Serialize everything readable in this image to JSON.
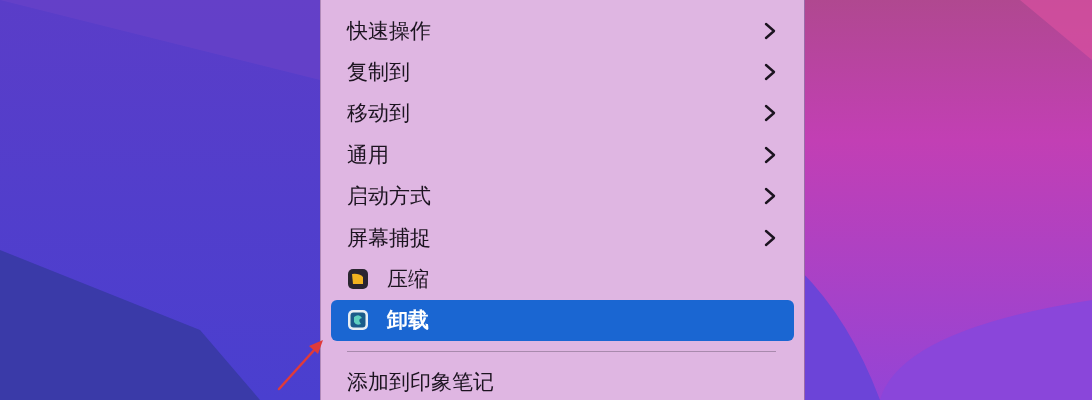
{
  "context_menu": {
    "items": [
      {
        "kind": "submenu",
        "label": "快速操作",
        "selected": false
      },
      {
        "kind": "submenu",
        "label": "复制到",
        "selected": false
      },
      {
        "kind": "submenu",
        "label": "移动到",
        "selected": false
      },
      {
        "kind": "submenu",
        "label": "通用",
        "selected": false
      },
      {
        "kind": "submenu",
        "label": "启动方式",
        "selected": false
      },
      {
        "kind": "submenu",
        "label": "屏幕捕捉",
        "selected": false
      },
      {
        "kind": "archive",
        "label": "压缩",
        "selected": false
      },
      {
        "kind": "uninstaller",
        "label": "卸载",
        "selected": true
      },
      {
        "kind": "separator"
      },
      {
        "kind": "action",
        "label": "添加到印象笔记",
        "selected": false
      }
    ]
  }
}
